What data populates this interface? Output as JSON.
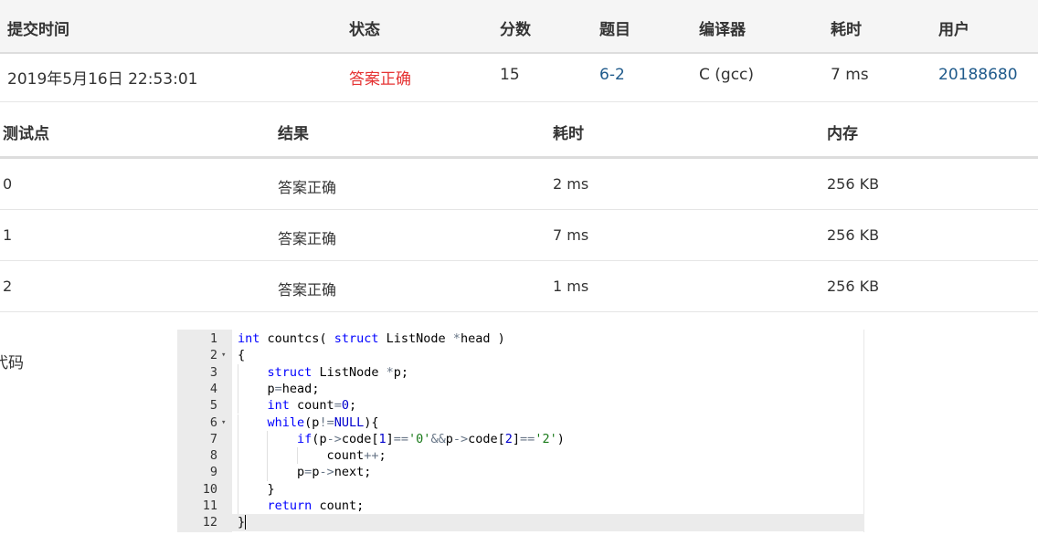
{
  "submission": {
    "headers": {
      "time": "提交时间",
      "status": "状态",
      "score": "分数",
      "problem": "题目",
      "compiler": "编译器",
      "duration": "耗时",
      "user": "用户"
    },
    "row": {
      "time": "2019年5月16日 22:53:01",
      "status": "答案正确",
      "score": "15",
      "problem": "6-2",
      "compiler": "C (gcc)",
      "duration": "7 ms",
      "user": "20188680"
    }
  },
  "testcases": {
    "headers": {
      "case": "测试点",
      "result": "结果",
      "duration": "耗时",
      "memory": "内存"
    },
    "rows": [
      {
        "case": "0",
        "result": "答案正确",
        "duration": "2 ms",
        "memory": "256 KB"
      },
      {
        "case": "1",
        "result": "答案正确",
        "duration": "7 ms",
        "memory": "256 KB"
      },
      {
        "case": "2",
        "result": "答案正确",
        "duration": "1 ms",
        "memory": "256 KB"
      }
    ]
  },
  "code": {
    "label": "代码",
    "line_numbers": [
      "1",
      "2",
      "3",
      "4",
      "5",
      "6",
      "7",
      "8",
      "9",
      "10",
      "11",
      "12"
    ],
    "active_line": "12",
    "lines": [
      "int countcs( struct ListNode *head )",
      "{",
      "    struct ListNode *p;",
      "    p=head;",
      "    int count=0;",
      "    while(p!=NULL){",
      "        if(p->code[1]=='0'&&p->code[2]=='2')",
      "            count++;",
      "        p=p->next;",
      "    }",
      "    return count;",
      "}"
    ],
    "fold_lines": [
      "2",
      "6"
    ]
  },
  "colors": {
    "accepted": "#e53333",
    "link": "#1f5a8b",
    "keyword": "#0000ff"
  }
}
